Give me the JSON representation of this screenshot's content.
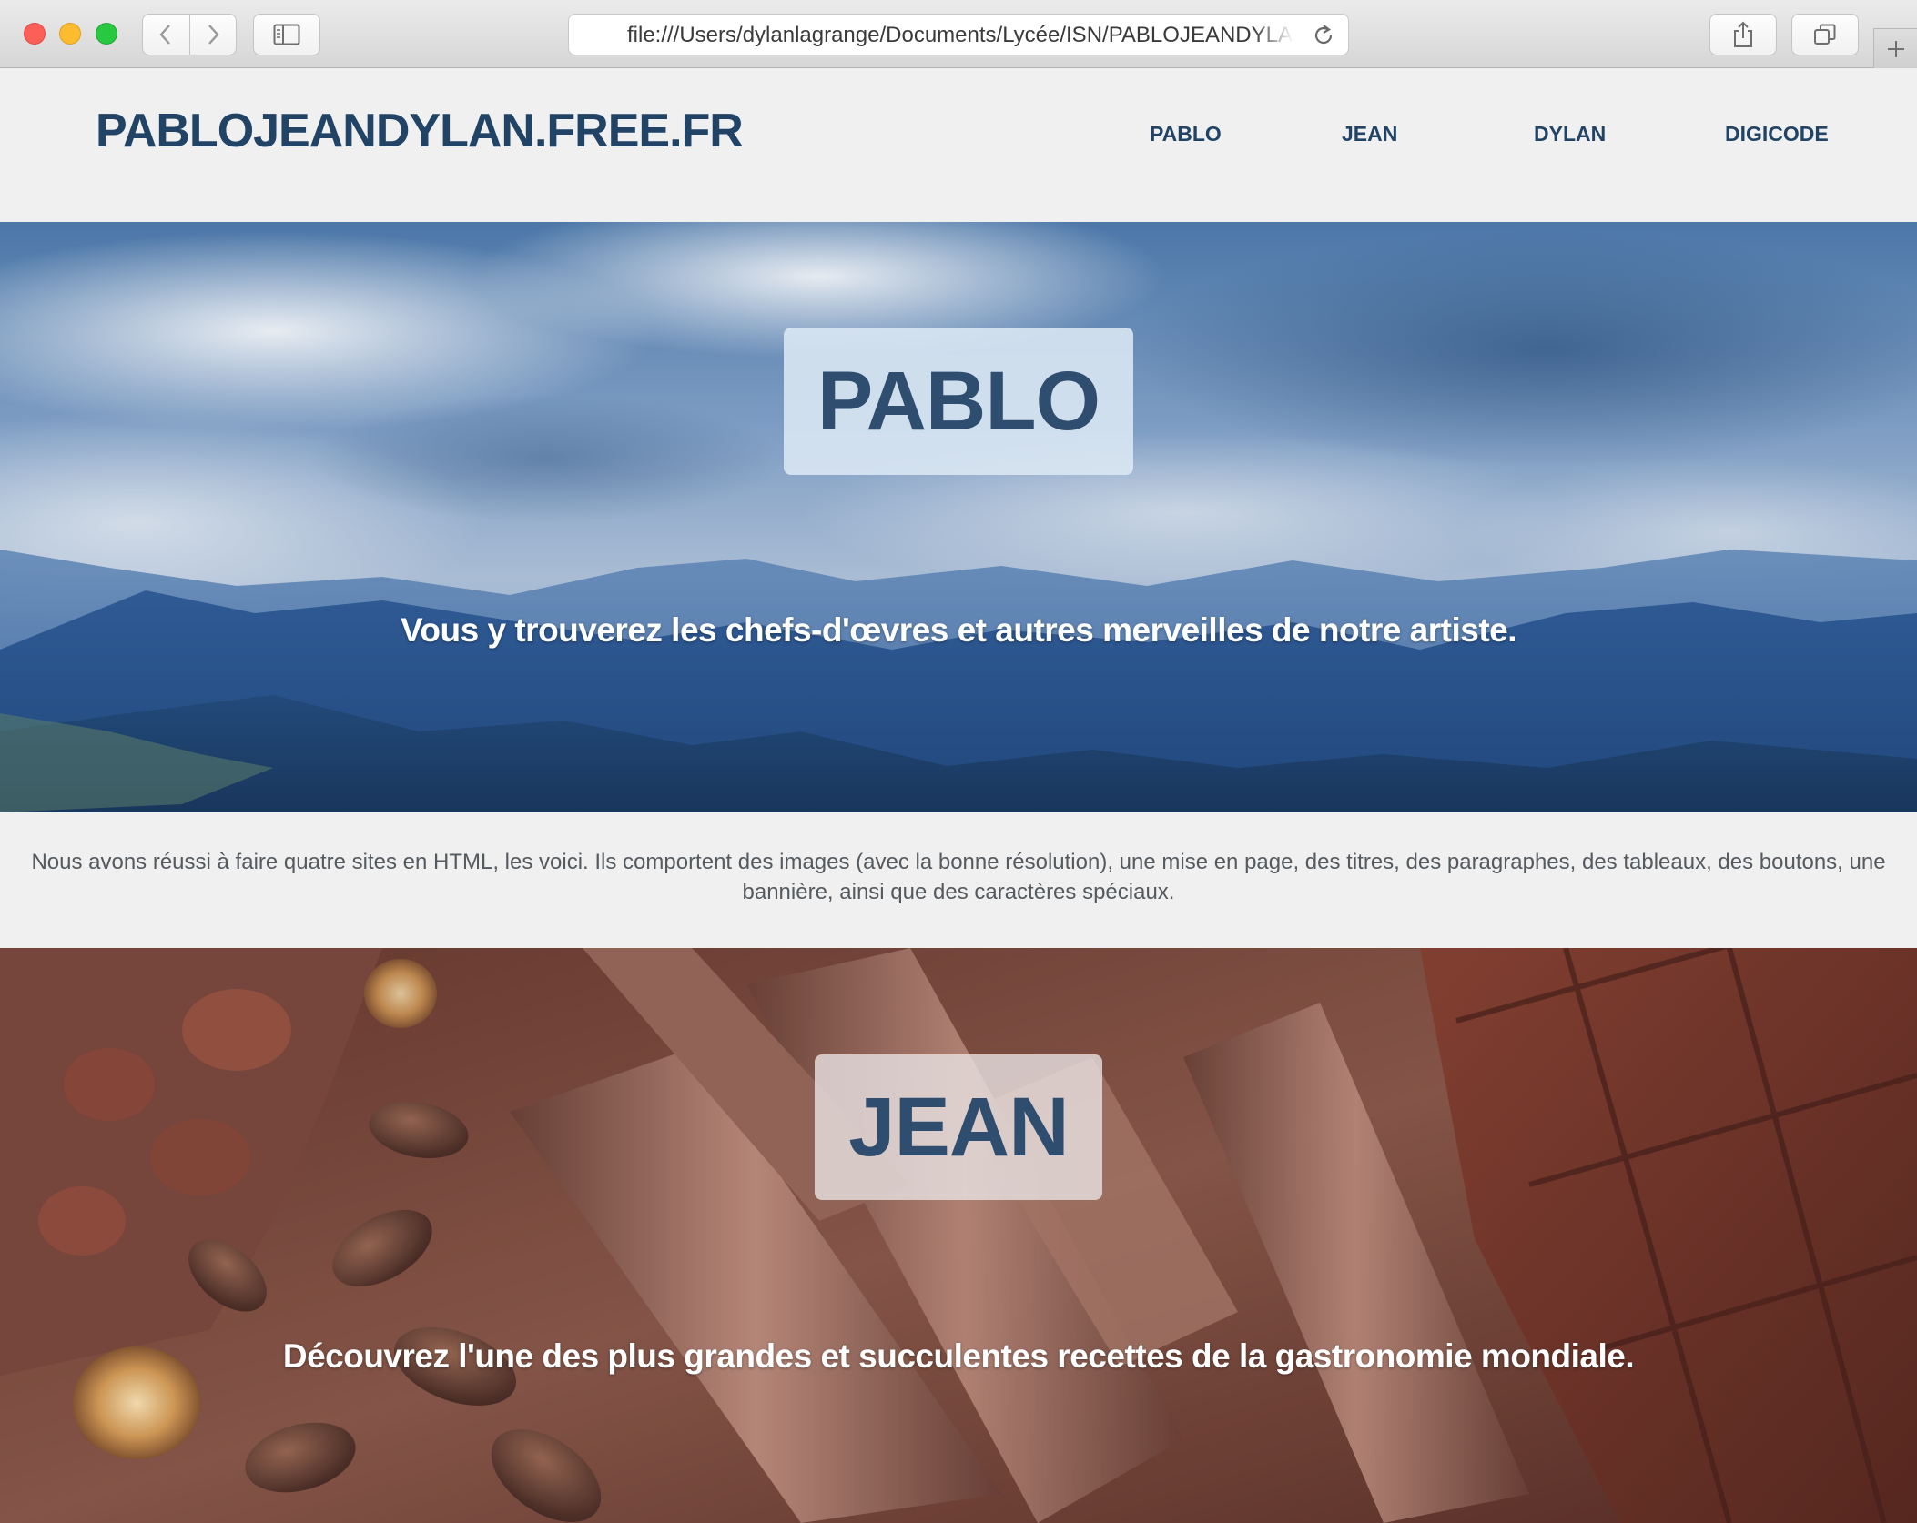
{
  "browser": {
    "address": "file:///Users/dylanlagrange/Documents/Lycée/ISN/PABLOJEANDYLAN",
    "icons": {
      "close": "close-icon",
      "minimize": "minimize-icon",
      "maximize": "maximize-icon",
      "back": "chevron-left-icon",
      "forward": "chevron-right-icon",
      "sidebar": "sidebar-icon",
      "reload": "reload-icon",
      "share": "share-icon",
      "tabs": "tabs-icon",
      "new_tab": "plus-icon"
    }
  },
  "site": {
    "logo": "PABLOJEANDYLAN.FREE.FR",
    "nav": {
      "pablo": "PABLO",
      "jean": "JEAN",
      "dylan": "DYLAN",
      "digicode": "DIGICODE"
    },
    "sections": {
      "pablo": {
        "title": "PABLO",
        "subtitle": "Vous y trouverez les chefs-d'œvres et autres merveilles de notre artiste."
      },
      "intro": "Nous avons réussi à faire quatre sites en HTML, les voici. Ils comportent des images (avec la bonne résolution), une mise en page, des titres, des paragraphes, des tableaux, des boutons, une bannière, ainsi que des caractères spéciaux.",
      "jean": {
        "title": "JEAN",
        "subtitle": "Découvrez l'une des plus grandes et succulentes recettes de la gastronomie mondiale."
      }
    },
    "colors": {
      "brand": "#214366",
      "title": "#2f4d6f",
      "header_bg": "#f0f0f0",
      "body_text": "#555a5f"
    }
  }
}
